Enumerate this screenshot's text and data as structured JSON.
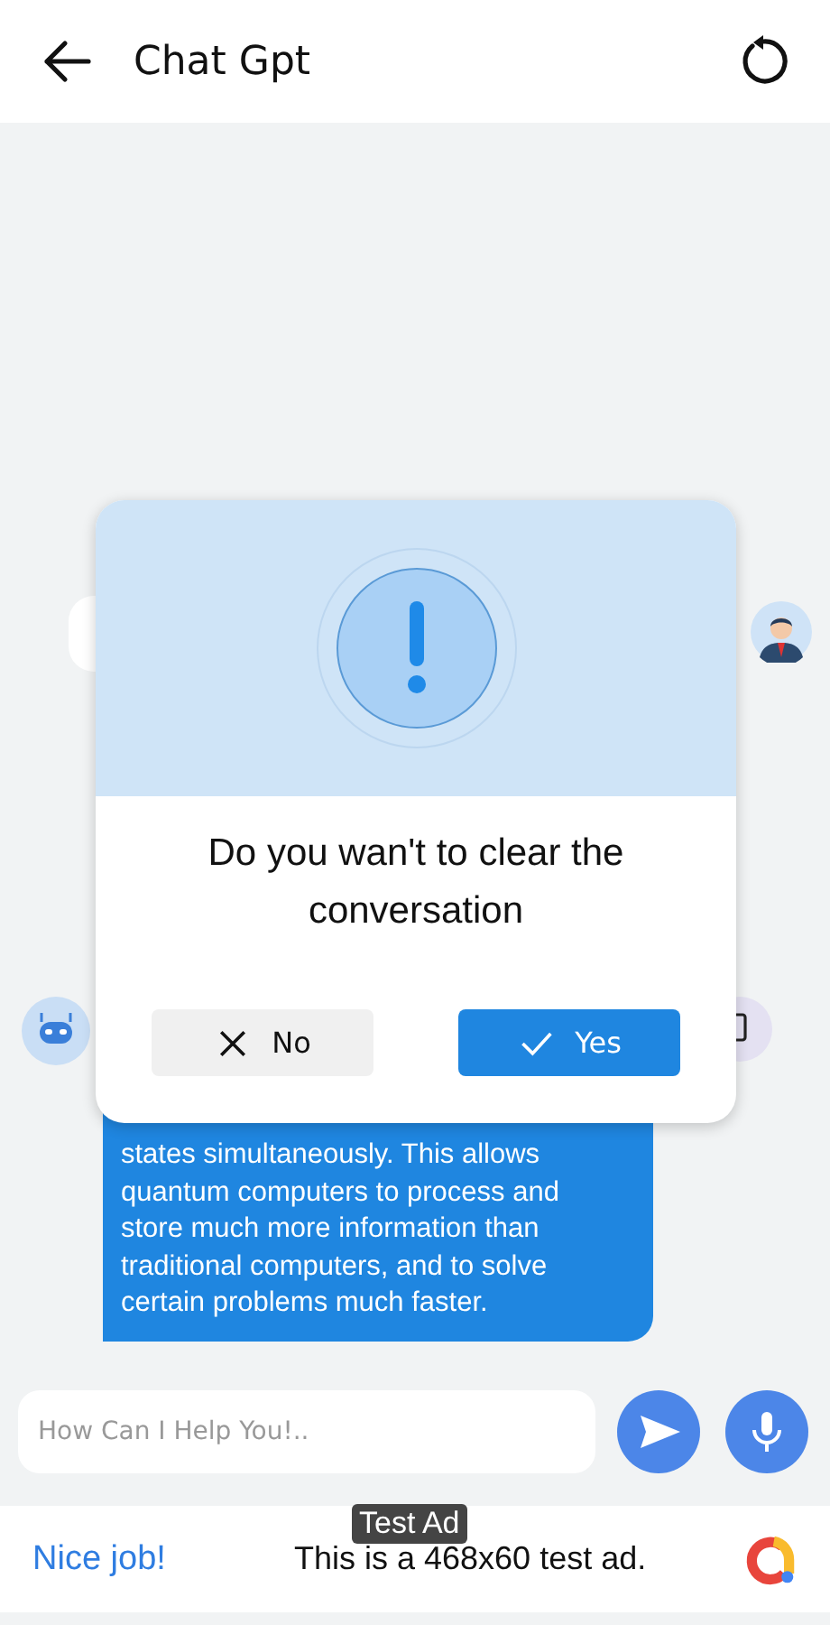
{
  "header": {
    "title": "Chat Gpt"
  },
  "messages": [
    {
      "kind": "user"
    },
    {
      "kind": "bot",
      "text": "states simultaneously. This allows quantum computers to process and store much more information than traditional computers, and to solve certain problems much faster."
    }
  ],
  "input": {
    "placeholder": "How Can I Help You!.."
  },
  "dialog": {
    "message": "Do you wan't to clear the conversation",
    "buttons": [
      {
        "label": "No",
        "kind": "cancel"
      },
      {
        "label": "Yes",
        "kind": "confirm"
      }
    ]
  },
  "ad": {
    "badge": "Test Ad",
    "headline": "Nice job!",
    "text": "This is a 468x60 test ad."
  }
}
